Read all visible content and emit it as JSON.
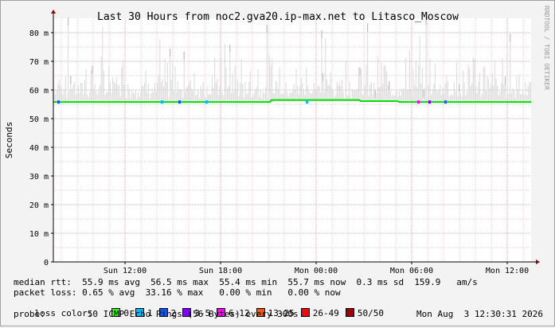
{
  "chart_data": {
    "type": "line",
    "title": "Last 30 Hours from noc2.gva20.ip-max.net to Litasco_Moscow",
    "ylabel": "Seconds",
    "ylim": [
      0,
      85
    ],
    "y_ticks": [
      0,
      10,
      20,
      30,
      40,
      50,
      60,
      70,
      80
    ],
    "y_tick_labels": [
      "0",
      "10 m",
      "20 m",
      "30 m",
      "40 m",
      "50 m",
      "60 m",
      "70 m",
      "80 m"
    ],
    "x_ticks": [
      {
        "label": "Sun 12:00",
        "hours": 4.5
      },
      {
        "label": "Sun 18:00",
        "hours": 10.5
      },
      {
        "label": "Mon 00:00",
        "hours": 16.5
      },
      {
        "label": "Mon 06:00",
        "hours": 22.5
      },
      {
        "label": "Mon 12:00",
        "hours": 28.5
      }
    ],
    "xlim_hours": [
      0,
      30
    ],
    "grid": true,
    "side_text": "RRDTOOL / TOBI OETIKER",
    "series": [
      {
        "name": "median rtt",
        "color": "#00e000",
        "x": [
          0,
          13.6,
          13.7,
          19.2,
          19.3,
          21.6,
          21.7,
          30
        ],
        "values": [
          55.8,
          55.8,
          56.5,
          56.5,
          56.1,
          56.1,
          55.8,
          55.8
        ]
      }
    ],
    "smoke_color": "#d8d8d8"
  },
  "stats": {
    "median_rtt": "median rtt:  55.9 ms avg  56.5 ms max  55.4 ms min  55.7 ms now  0.3 ms sd  159.9   am/s",
    "packet_loss": "packet loss: 0.65 % avg  33.16 % max   0.00 % min   0.00 % now",
    "loss_color_label": "loss color:",
    "probe": "probe:        50 ICMP Echo Pings (56 Bytes) every 300s",
    "timestamp": "Mon Aug  3 12:30:31 2026"
  },
  "loss_colors": [
    {
      "label": "0",
      "color": "#26ff00"
    },
    {
      "label": "1",
      "color": "#00b8ff"
    },
    {
      "label": "2",
      "color": "#0059ff"
    },
    {
      "label": "3-5",
      "color": "#7e00ff"
    },
    {
      "label": "6-12",
      "color": "#ff00ff"
    },
    {
      "label": "13-25",
      "color": "#ff5500"
    },
    {
      "label": "26-49",
      "color": "#ff0000"
    },
    {
      "label": "50/50",
      "color": "#a10000"
    }
  ]
}
